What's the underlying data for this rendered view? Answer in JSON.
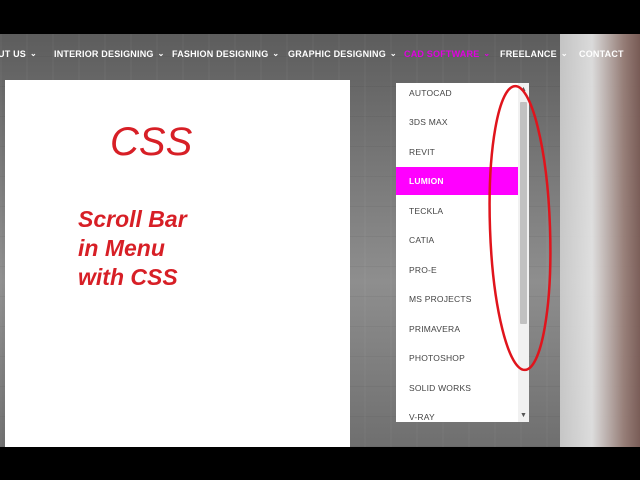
{
  "nav": {
    "items": [
      {
        "label": "UT US",
        "chevron": true
      },
      {
        "label": "INTERIOR DESIGNING",
        "chevron": true
      },
      {
        "label": "FASHION DESIGNING",
        "chevron": true
      },
      {
        "label": "GRAPHIC DESIGNING",
        "chevron": true
      },
      {
        "label": "CAD SOFTWARE",
        "chevron": true,
        "active": true
      },
      {
        "label": "FREELANCE",
        "chevron": true
      },
      {
        "label": "CONTACT",
        "chevron": false
      }
    ],
    "chevron_glyph": "⌄"
  },
  "annotation": {
    "title": "CSS",
    "caption_lines": [
      "Scroll Bar",
      "in Menu",
      "with CSS"
    ]
  },
  "dropdown": {
    "items": [
      "AUTOCAD",
      "3DS MAX",
      "REVIT",
      "LUMION",
      "TECKLA",
      "CATIA",
      "PRO-E",
      "MS PROJECTS",
      "PRIMAVERA",
      "PHOTOSHOP",
      "SOLID WORKS",
      "V-RAY"
    ],
    "highlighted_item": "LUMION",
    "scroll_up_glyph": "▲",
    "scroll_down_glyph": "▼"
  },
  "colors": {
    "accent_magenta": "#ff00ff",
    "active_nav": "#e000e0",
    "annotation_red": "#d71f26"
  }
}
